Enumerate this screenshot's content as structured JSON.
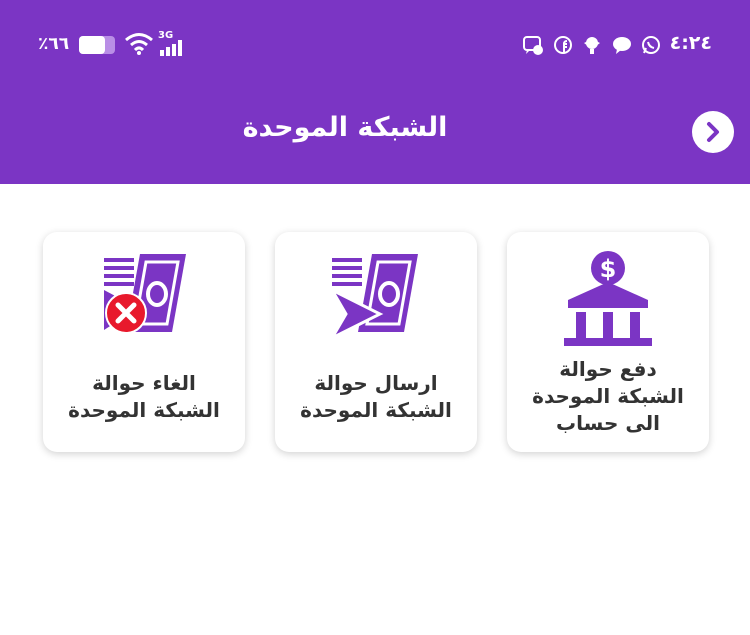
{
  "status_bar": {
    "time": "٤:٢٤",
    "battery_percent": "٪٦٦",
    "network": "3G",
    "battery_level": 0.66
  },
  "header": {
    "title": "الشبكة الموحدة",
    "back_icon": "chevron-right-icon"
  },
  "colors": {
    "primary": "#7b35c4",
    "card_text": "#333333",
    "cancel": "#e8192c"
  },
  "services": [
    {
      "icon": "bank-dollar-icon",
      "label_line1": "دفع حوالة",
      "label_line2": "الشبكة الموحدة",
      "label_line3": "الى حساب"
    },
    {
      "icon": "send-money-icon",
      "label_line1": "ارسال حوالة",
      "label_line2": "الشبكة الموحدة"
    },
    {
      "icon": "cancel-money-icon",
      "label_line1": "الغاء حوالة",
      "label_line2": "الشبكة الموحدة"
    }
  ]
}
